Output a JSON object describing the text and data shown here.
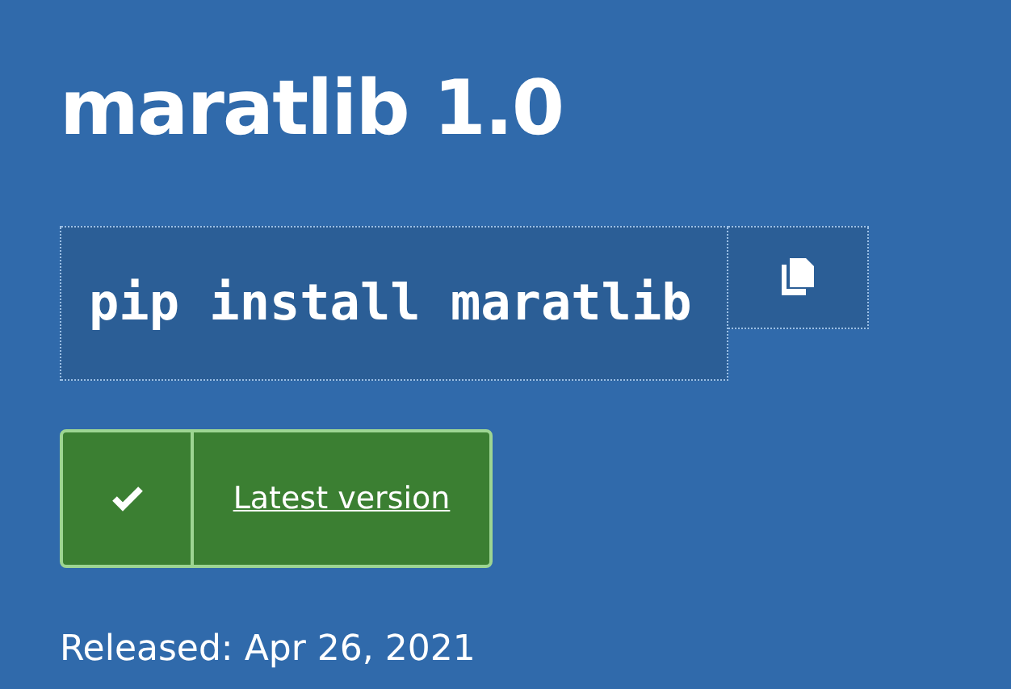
{
  "title": "maratlib 1.0",
  "install_command": "pip install maratlib",
  "version_badge": {
    "label": "Latest version"
  },
  "released": "Released: Apr 26, 2021"
}
